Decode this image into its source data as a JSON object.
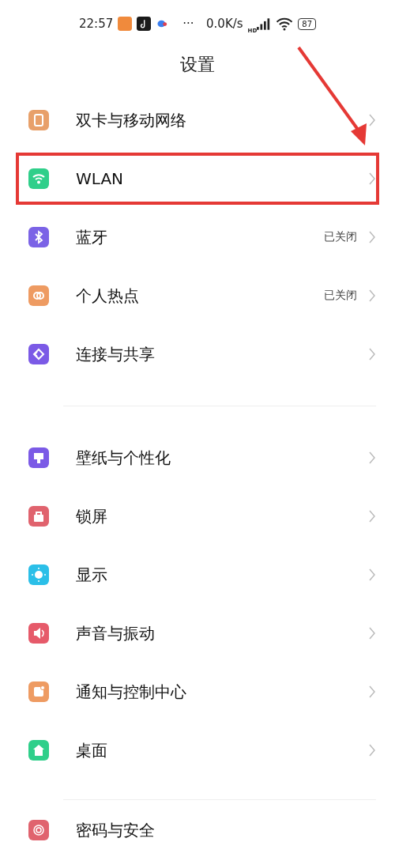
{
  "status_bar": {
    "time": "22:57",
    "more": "···",
    "speed": "0.0K/s",
    "network_badge": "HD",
    "battery": "87"
  },
  "title": "设置",
  "sections": [
    {
      "items": [
        {
          "label": "双卡与移动网络",
          "color": "#e8a06a",
          "highlighted": false
        },
        {
          "label": "WLAN",
          "color": "#2fcf8a",
          "highlighted": true
        },
        {
          "label": "蓝牙",
          "value": "已关闭",
          "color": "#7b63e6",
          "highlighted": false
        },
        {
          "label": "个人热点",
          "value": "已关闭",
          "color": "#ee9b62",
          "highlighted": false
        },
        {
          "label": "连接与共享",
          "color": "#7b5ae6",
          "highlighted": false
        }
      ]
    },
    {
      "items": [
        {
          "label": "壁纸与个性化",
          "color": "#7b5ae6",
          "highlighted": false
        },
        {
          "label": "锁屏",
          "color": "#e0636e",
          "highlighted": false
        },
        {
          "label": "显示",
          "color": "#2bbfe8",
          "highlighted": false
        },
        {
          "label": "声音与振动",
          "color": "#e65a6a",
          "highlighted": false
        },
        {
          "label": "通知与控制中心",
          "color": "#ee9b62",
          "highlighted": false
        },
        {
          "label": "桌面",
          "color": "#2fcf8a",
          "highlighted": false
        }
      ]
    },
    {
      "items": [
        {
          "label": "密码与安全",
          "color": "#e0636e",
          "highlighted": false
        }
      ]
    }
  ]
}
